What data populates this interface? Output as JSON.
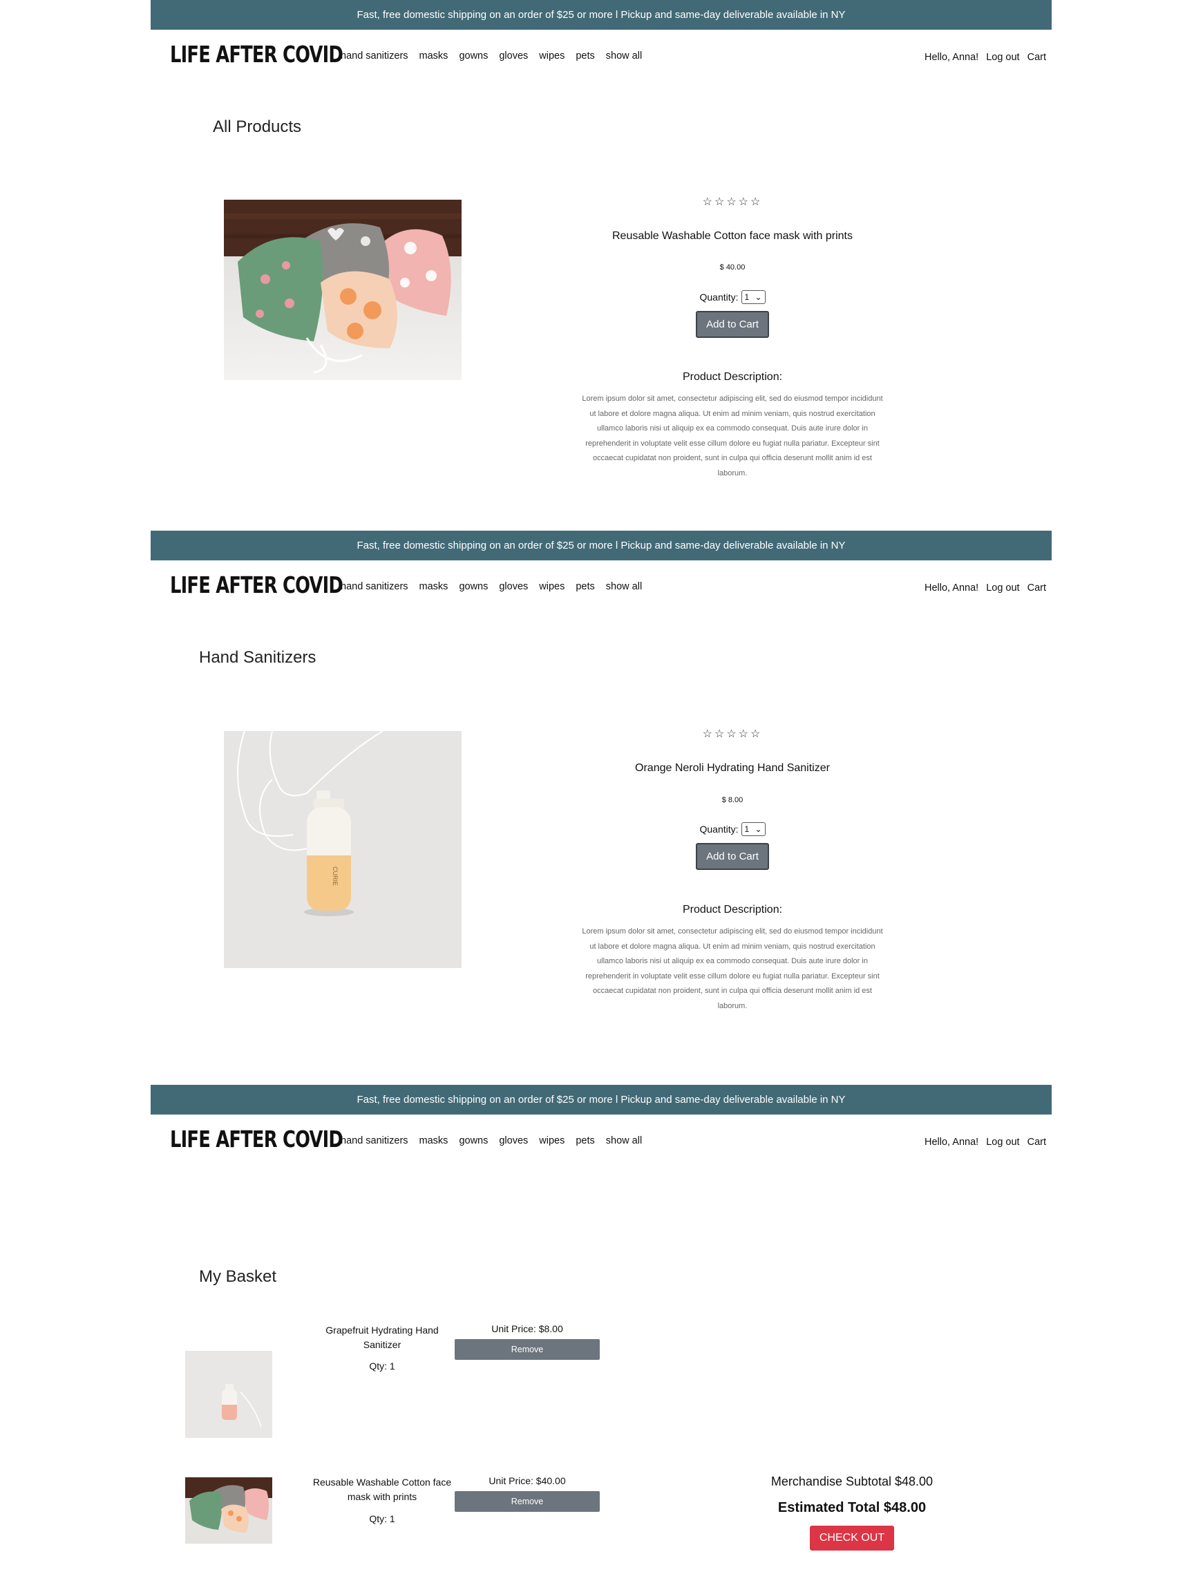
{
  "banner": {
    "text": "Fast, free domestic shipping on an order of $25 or more l Pickup and same-day deliverable available in NY"
  },
  "brand": {
    "logo": "LIFE AFTER COVID"
  },
  "nav": {
    "items": [
      "hand sanitizers",
      "masks",
      "gowns",
      "gloves",
      "wipes",
      "pets",
      "show all"
    ]
  },
  "user": {
    "greeting": "Hello, Anna!",
    "logout": "Log out",
    "cart": "Cart"
  },
  "colors": {
    "banner": "#426a76",
    "button": "#6c757d",
    "checkout": "#dc3545"
  },
  "pages": {
    "all_products": {
      "title": "All Products",
      "product": {
        "stars": "☆☆☆☆☆",
        "name": "Reusable Washable Cotton face mask with prints",
        "price": "$ 40.00",
        "quantity_label": "Quantity:",
        "quantity_value": "1",
        "add_button": "Add to Cart",
        "description_title": "Product Description:",
        "description": "Lorem ipsum dolor sit amet, consectetur adipiscing elit, sed do eiusmod tempor incididunt ut labore et dolore magna aliqua. Ut enim ad minim veniam, quis nostrud exercitation ullamco laboris nisi ut aliquip ex ea commodo consequat. Duis aute irure dolor in reprehenderit in voluptate velit esse cillum dolore eu fugiat nulla pariatur. Excepteur sint occaecat cupidatat non proident, sunt in culpa qui officia deserunt mollit anim id est laborum."
      }
    },
    "hand_sanitizers": {
      "title": "Hand Sanitizers",
      "product": {
        "stars": "☆☆☆☆☆",
        "name": "Orange Neroli Hydrating Hand Sanitizer",
        "price": "$ 8.00",
        "quantity_label": "Quantity:",
        "quantity_value": "1",
        "add_button": "Add to Cart",
        "description_title": "Product Description:",
        "description": "Lorem ipsum dolor sit amet, consectetur adipiscing elit, sed do eiusmod tempor incididunt ut labore et dolore magna aliqua. Ut enim ad minim veniam, quis nostrud exercitation ullamco laboris nisi ut aliquip ex ea commodo consequat. Duis aute irure dolor in reprehenderit in voluptate velit esse cillum dolore eu fugiat nulla pariatur. Excepteur sint occaecat cupidatat non proident, sunt in culpa qui officia deserunt mollit anim id est laborum.",
        "bottle_label": "CURIE"
      }
    },
    "basket": {
      "title": "My Basket",
      "items": [
        {
          "name": "Grapefruit Hydrating Hand Sanitizer",
          "qty": "Qty: 1",
          "unit_price": "Unit Price: $8.00",
          "remove": "Remove"
        },
        {
          "name": "Reusable Washable Cotton face mask with prints",
          "qty": "Qty: 1",
          "unit_price": "Unit Price: $40.00",
          "remove": "Remove"
        }
      ],
      "subtotal": "Merchandise Subtotal $48.00",
      "total": "Estimated Total $48.00",
      "checkout": "CHECK OUT"
    }
  }
}
